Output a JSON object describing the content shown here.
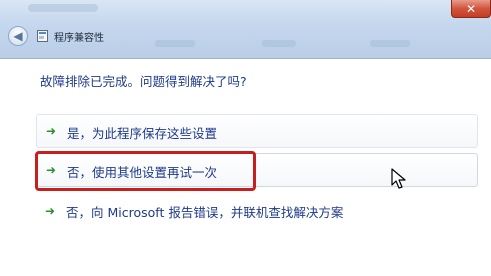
{
  "window": {
    "title": "程序兼容性",
    "close_glyph": "✕"
  },
  "icons": {
    "back": "back-arrow-icon",
    "app": "program-icon",
    "option_arrow": "green-arrow-icon",
    "cursor": "mouse-pointer-icon"
  },
  "colors": {
    "link_text": "#1e3a8a",
    "arrow_green": "#2f8f2f",
    "highlight_red": "#c81e1e",
    "titlebar": "#c6d8ee"
  },
  "main": {
    "question": "故障排除已完成。问题得到解决了吗?",
    "options": [
      {
        "label": "是，为此程序保存这些设置"
      },
      {
        "label": "否，使用其他设置再试一次"
      },
      {
        "label": "否，向 Microsoft 报告错误，并联机查找解决方案"
      }
    ]
  }
}
